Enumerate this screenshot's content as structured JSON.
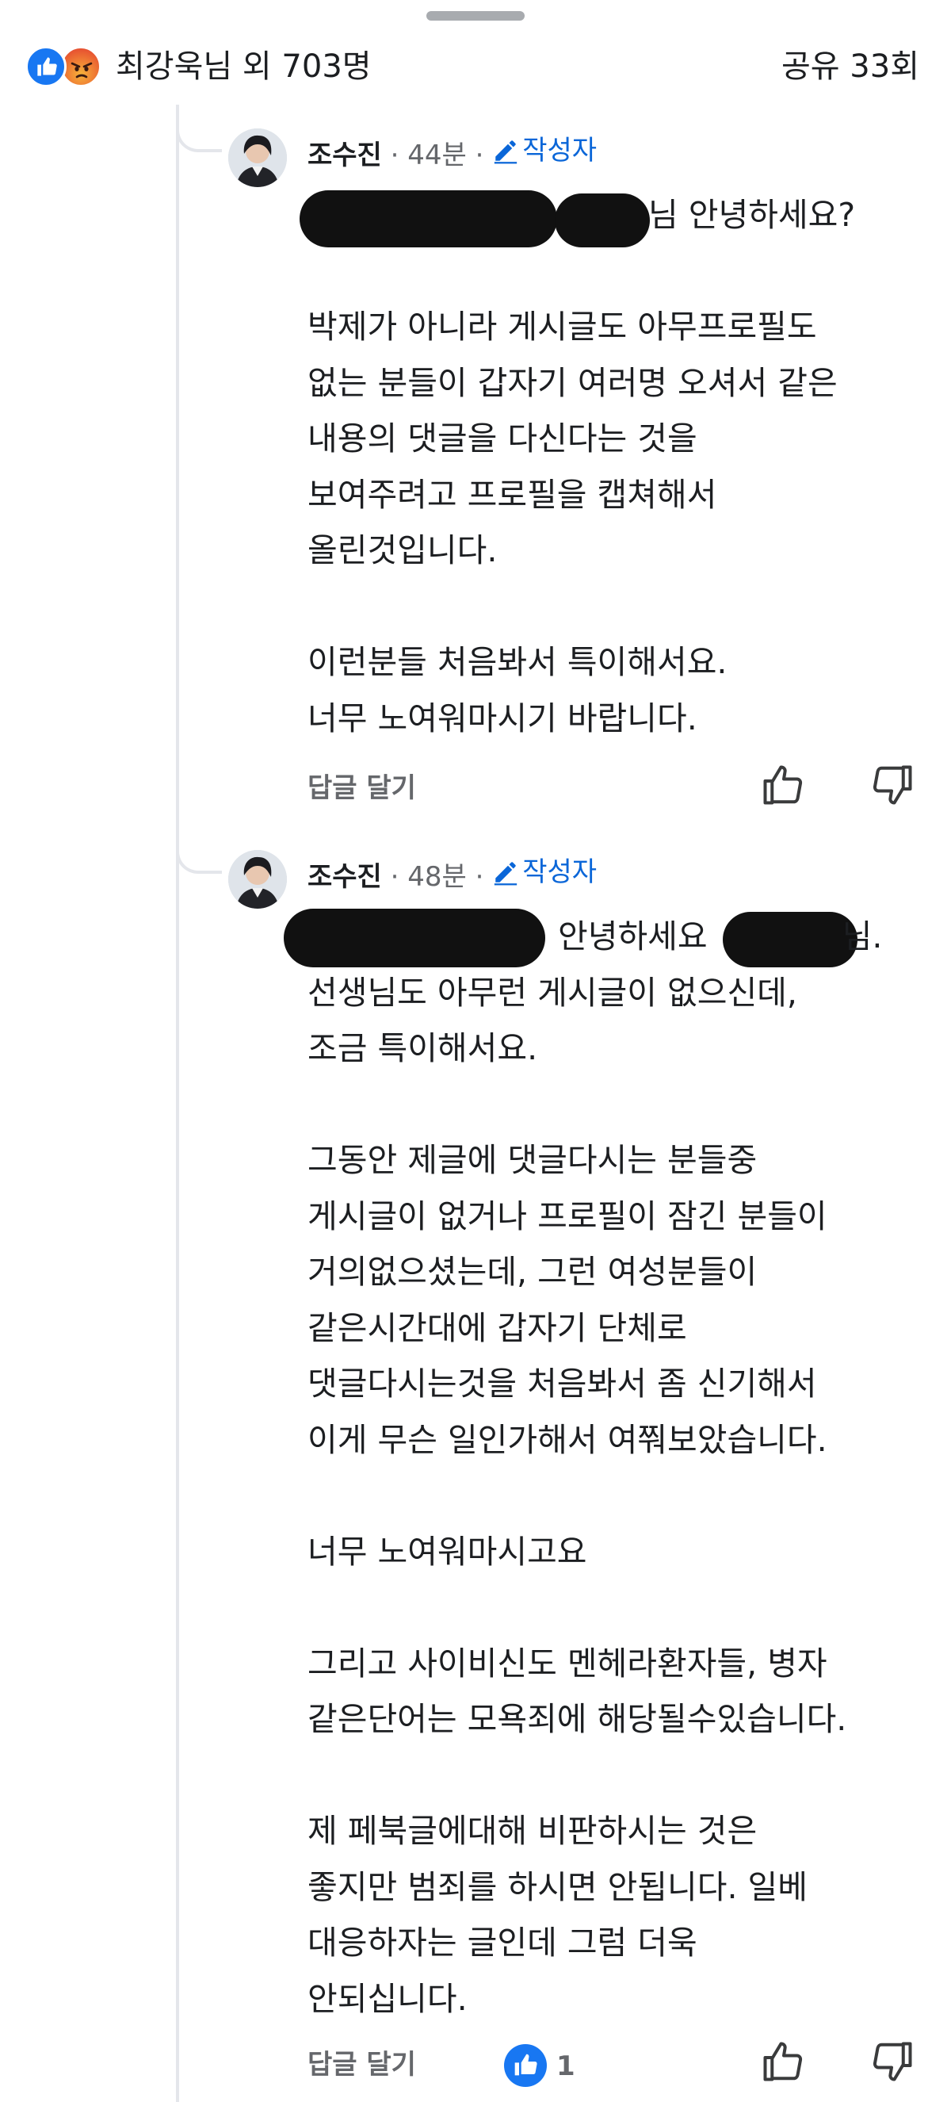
{
  "header": {
    "reactions_summary": "최강욱님 외 703명",
    "shares": "공유 33회",
    "reaction_icons": [
      "like-icon",
      "angry-icon"
    ]
  },
  "comments": [
    {
      "author": "조수진",
      "time": "· 44분 ·",
      "badge": "작성자",
      "lines": [
        "님 안녕하세요?",
        "",
        "박제가 아니라 게시글도 아무프로필도",
        "없는 분들이 갑자기 여러명 오셔서 같은",
        "내용의 댓글을 다신다는 것을",
        "보여주려고 프로필을 캡쳐해서",
        "올린것입니다.",
        "",
        "이런분들 처음봐서 특이해서요.",
        "너무 노여워마시기 바랍니다."
      ],
      "reply_label": "답글 달기"
    },
    {
      "author": "조수진",
      "time": "· 48분 ·",
      "badge": "작성자",
      "lines": [
        "안녕하세요",
        "선생님도 아무런 게시글이 없으신데,",
        "조금 특이해서요.",
        "",
        "그동안 제글에 댓글다시는 분들중",
        "게시글이 없거나 프로필이 잠긴 분들이",
        "거의없으셨는데, 그런 여성분들이",
        "같은시간대에 갑자기 단체로",
        "댓글다시는것을 처음봐서 좀 신기해서",
        "이게 무슨 일인가해서 여쭤보았습니다.",
        "",
        "너무 노여워마시고요",
        "",
        "그리고 사이비신도  멘헤라환자들, 병자",
        "같은단어는 모욕죄에 해당될수있습니다.",
        "",
        "제 페북글에대해  비판하시는 것은",
        "좋지만 범죄를 하시면 안됩니다. 일베",
        "대응하자는 글인데 그럼 더욱",
        "안되십니다."
      ],
      "line1_suffix": "님.",
      "reply_label": "답글 달기",
      "like_count": "1"
    }
  ],
  "colors": {
    "accent": "#1877f2",
    "badge": "#0a66d8",
    "muted": "#65676b",
    "text": "#1c1e21"
  }
}
